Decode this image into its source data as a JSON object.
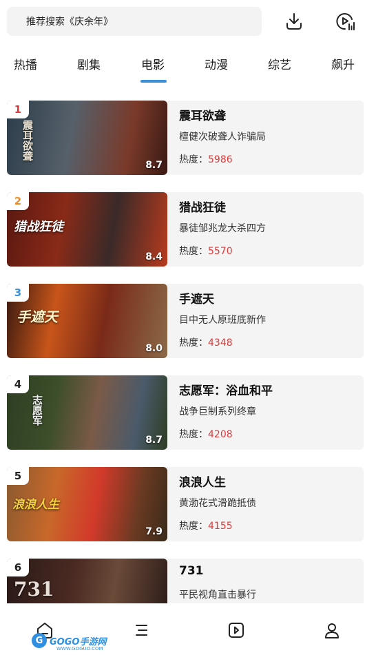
{
  "search": {
    "placeholder_text": "推荐搜索《庆余年》"
  },
  "top_icons": [
    "download-icon",
    "play-list-icon"
  ],
  "tabs": [
    {
      "label": "热播"
    },
    {
      "label": "剧集"
    },
    {
      "label": "电影",
      "active": true
    },
    {
      "label": "动漫"
    },
    {
      "label": "综艺"
    },
    {
      "label": "飙升"
    }
  ],
  "heat_label": "热度：",
  "items": [
    {
      "rank": "1",
      "rank_color": "#e23a3a",
      "score": "8.7",
      "title": "震耳欲聋",
      "desc": "檀健次破聋人诈骗局",
      "heat": "5986",
      "poster_text": "震耳欲聋"
    },
    {
      "rank": "2",
      "rank_color": "#f08a24",
      "score": "8.4",
      "title": "猎战狂徒",
      "desc": "暴徒邹兆龙大杀四方",
      "heat": "5570",
      "poster_text": "猎战狂徒"
    },
    {
      "rank": "3",
      "rank_color": "#3b8fd9",
      "score": "8.0",
      "title": "手遮天",
      "desc": "目中无人原班底新作",
      "heat": "4348",
      "poster_text": "手遮天"
    },
    {
      "rank": "4",
      "rank_color": "#222222",
      "score": "8.7",
      "title": "志愿军：浴血和平",
      "desc": "战争巨制系列终章",
      "heat": "4208",
      "poster_text": "志愿军"
    },
    {
      "rank": "5",
      "rank_color": "#222222",
      "score": "7.9",
      "title": "浪浪人生",
      "desc": "黄渤花式滑跪抵债",
      "heat": "4155",
      "poster_text": "浪浪人生"
    },
    {
      "rank": "6",
      "rank_color": "#222222",
      "score": "",
      "title": "731",
      "desc": "平民视角直击暴行",
      "heat": "",
      "poster_text": "731"
    }
  ],
  "bottom_nav": [
    "home-icon",
    "menu-icon",
    "play-icon",
    "profile-icon"
  ],
  "watermark": {
    "circle": "G",
    "text": "GOGO手游网",
    "sub": "WWW.GOGUO.COM"
  }
}
